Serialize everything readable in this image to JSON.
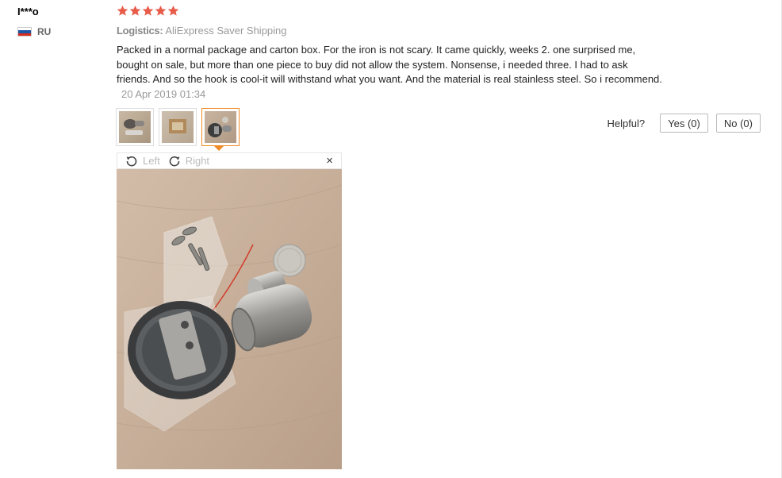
{
  "user": {
    "name": "I***o",
    "country": "RU",
    "flag_colors": [
      "#ffffff",
      "#1c57a5",
      "#d52b1e"
    ]
  },
  "rating": {
    "stars": 5,
    "max": 5,
    "color": "#e85c4a"
  },
  "logistics": {
    "label": "Logistics:",
    "value": "AliExpress Saver Shipping"
  },
  "review": {
    "text": "Packed in a normal package and carton box. For the iron is not scary. It came quickly, weeks 2. one surprised me, bought on sale, but more than one piece to buy did not allow the system. Nonsense, i needed three. I had to ask friends. And so the hook is cool-it will withstand what you want. And the material is real stainless steel. So i recommend.",
    "date": "20 Apr 2019 01:34"
  },
  "thumbnails": {
    "count": 3,
    "active_index": 2,
    "accent": "#f08a24"
  },
  "helpful": {
    "label": "Helpful?",
    "yes": "Yes (0)",
    "no": "No (0)"
  },
  "viewer": {
    "rotate_left": "Left",
    "rotate_right": "Right",
    "close": "×"
  }
}
